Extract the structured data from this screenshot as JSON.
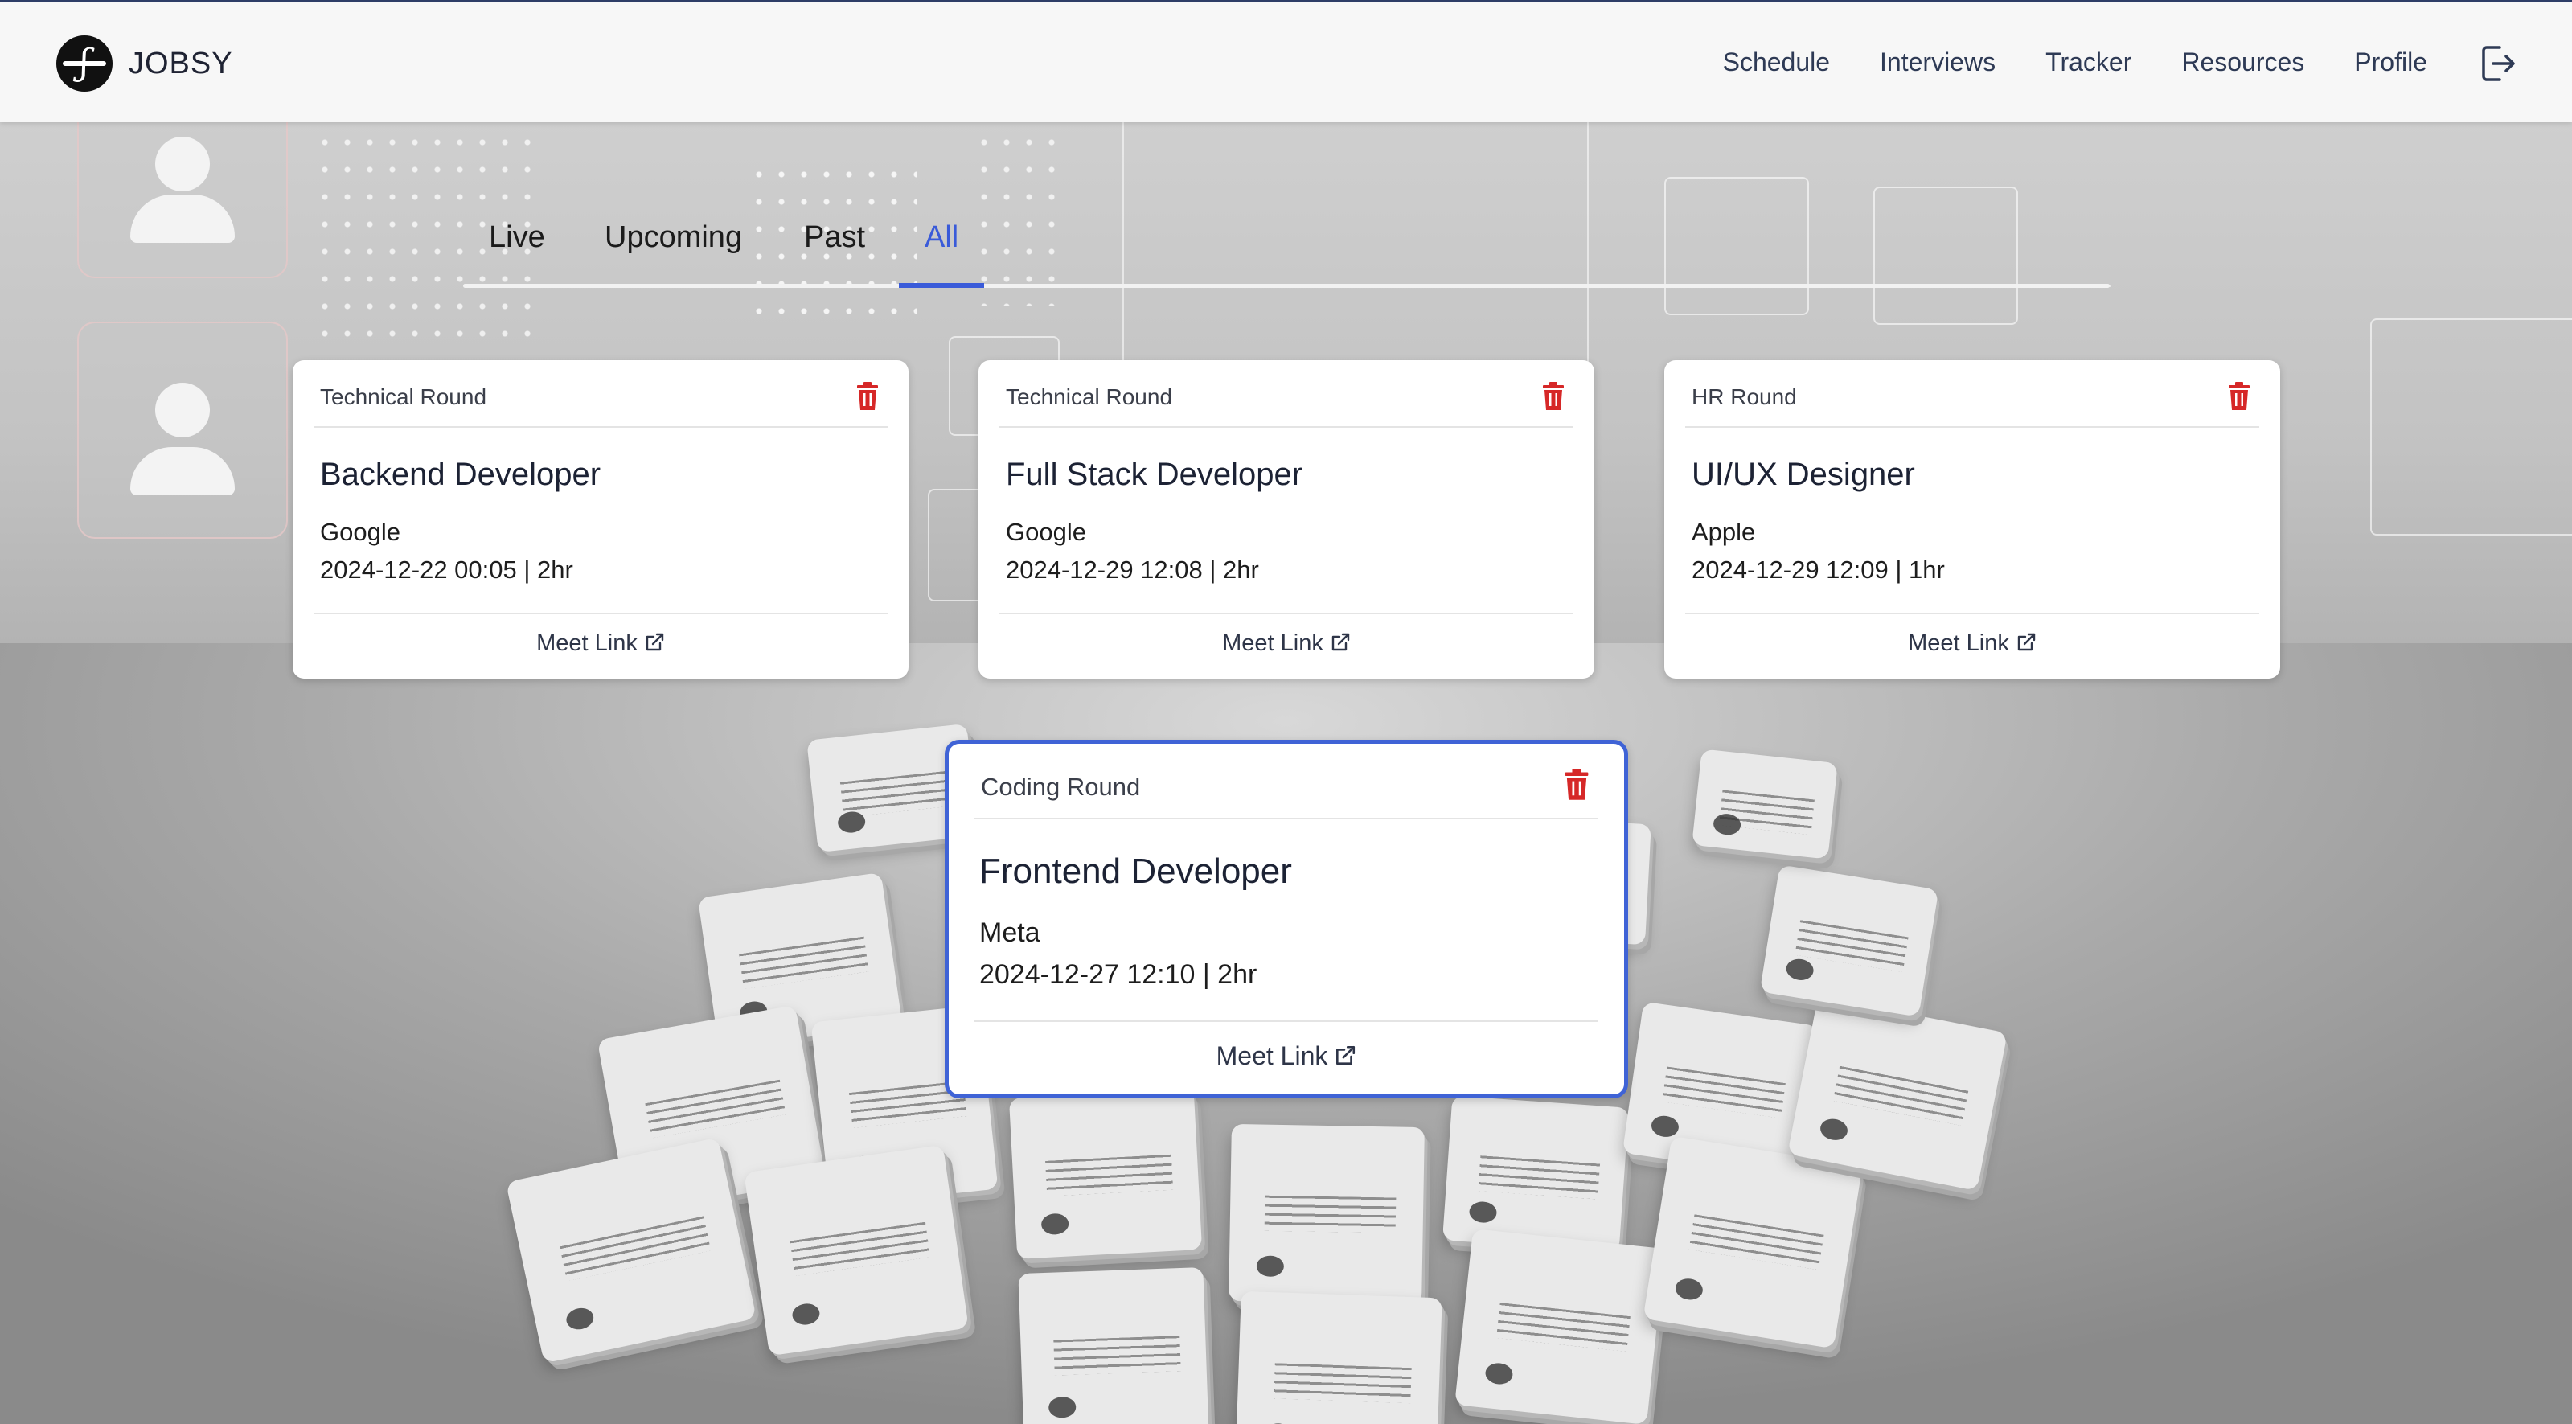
{
  "app": {
    "name": "JOBSY"
  },
  "nav": {
    "links": [
      {
        "label": "Schedule"
      },
      {
        "label": "Interviews"
      },
      {
        "label": "Tracker"
      },
      {
        "label": "Resources"
      },
      {
        "label": "Profile"
      }
    ],
    "logout_icon": "logout-icon"
  },
  "tabs": {
    "items": [
      {
        "label": "Live"
      },
      {
        "label": "Upcoming"
      },
      {
        "label": "Past"
      },
      {
        "label": "All"
      }
    ],
    "active": "All"
  },
  "accent_color": "#3a5bd9",
  "delete_color": "#d62828",
  "interviews": [
    {
      "round": "Technical Round",
      "role": "Backend Developer",
      "company": "Google",
      "datetime": "2024-12-22 00:05 | 2hr",
      "link_label": "Meet Link"
    },
    {
      "round": "Technical Round",
      "role": "Full Stack Developer",
      "company": "Google",
      "datetime": "2024-12-29 12:08 | 2hr",
      "link_label": "Meet Link"
    },
    {
      "round": "HR Round",
      "role": "UI/UX Designer",
      "company": "Apple",
      "datetime": "2024-12-29 12:09 | 1hr",
      "link_label": "Meet Link"
    },
    {
      "round": "Coding Round",
      "role": "Frontend Developer",
      "company": "Meta",
      "datetime": "2024-12-27 12:10 | 2hr",
      "link_label": "Meet Link"
    }
  ]
}
